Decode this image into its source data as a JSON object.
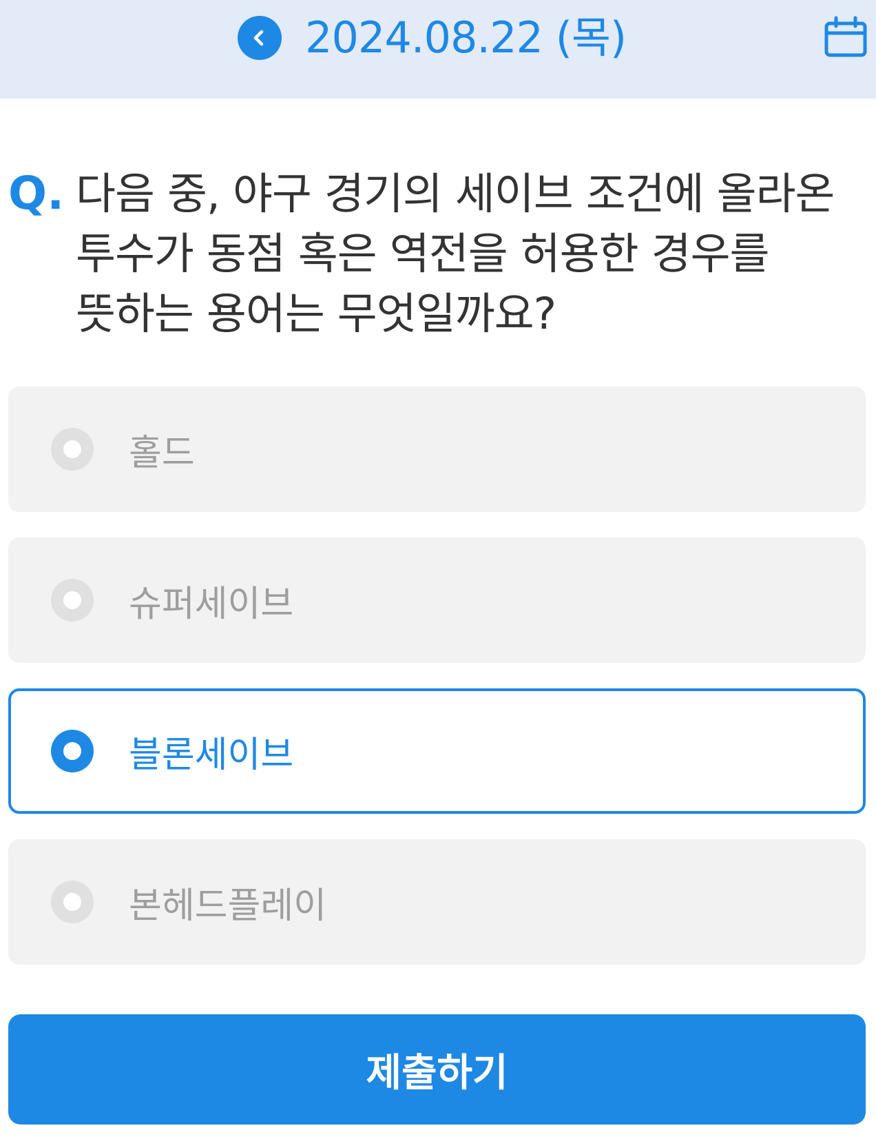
{
  "header": {
    "back_icon": "chevron-left-icon",
    "date": "2024.08.22 (목)",
    "calendar_icon": "calendar-icon"
  },
  "question": {
    "marker": "Q.",
    "text": "다음 중, 야구 경기의 세이브 조건에 올라온 투수가 동점 혹은 역전을 허용한 경우를 뜻하는 용어는 무엇일까요?"
  },
  "options": [
    {
      "label": "홀드",
      "selected": false
    },
    {
      "label": "슈퍼세이브",
      "selected": false
    },
    {
      "label": "블론세이브",
      "selected": true
    },
    {
      "label": "본헤드플레이",
      "selected": false
    }
  ],
  "submit": {
    "label": "제출하기"
  },
  "colors": {
    "accent": "#1e88e5",
    "header_bg": "#e2ebf7",
    "option_bg": "#f2f2f2",
    "option_text": "#9e9e9e",
    "question_text": "#333333"
  }
}
